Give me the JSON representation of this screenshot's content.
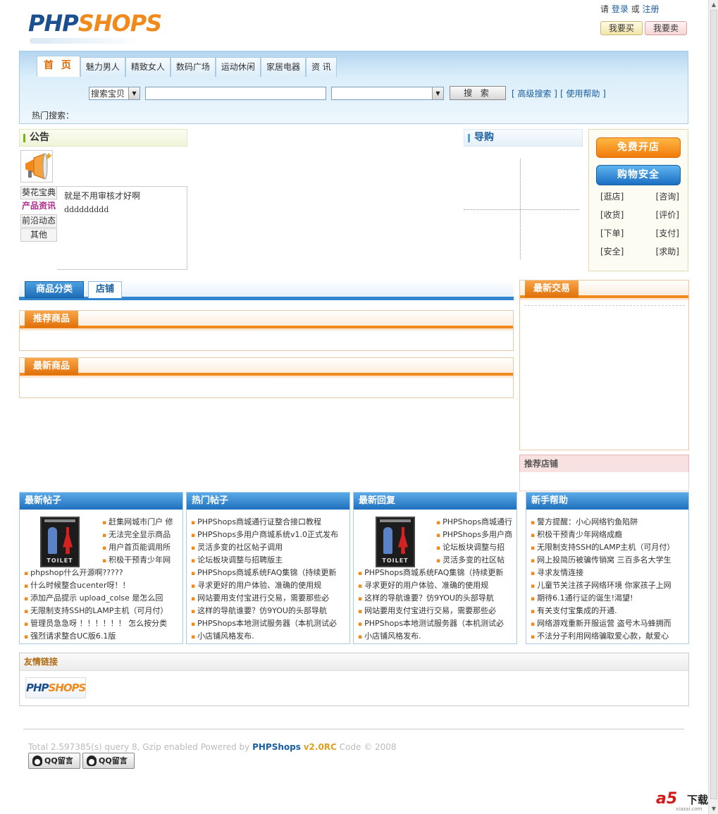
{
  "header": {
    "logo_php": "PHP",
    "logo_shops": "SHOPS",
    "userbar_prefix": "请",
    "login": "登录",
    "or": "或",
    "register": "注册",
    "buy_btn": "我要买",
    "sell_btn": "我要卖"
  },
  "nav": {
    "tabs": [
      "首 页",
      "魅力男人",
      "精致女人",
      "数码广场",
      "运动休闲",
      "家居电器",
      "资 讯"
    ],
    "search_type": "搜索宝贝",
    "search_value": "",
    "search_btn": "搜 索",
    "adv_search": "[ 高级搜索 ]",
    "help": "[ 使用帮助 ]",
    "hot_search": "热门搜索："
  },
  "notice": {
    "title": "公告",
    "cats": [
      "葵花宝典",
      "产品资讯",
      "前沿动态",
      "其他"
    ],
    "line1": "就是不用审核才好啊",
    "line2": "ddddddddd"
  },
  "guide": {
    "title": "导购"
  },
  "rightpanel": {
    "open_btn": "免费开店",
    "safe_btn": "购物安全",
    "links": [
      "[逛店]",
      "[咨询]",
      "[收货]",
      "[评价]",
      "[下单]",
      "[支付]",
      "[安全]",
      "[求助]"
    ]
  },
  "sections": {
    "cat_tab": "商品分类",
    "store_tab": "店铺",
    "recommend": "推荐商品",
    "newest": "最新商品",
    "latest_trade": "最新交易",
    "rec_store": "推荐店铺"
  },
  "posts": {
    "latest": {
      "title": "最新帖子",
      "items": [
        "赶集网城市门户 修",
        "无法完全显示商品",
        "用户首页能调用所",
        "积极干预青少年网",
        "phpshop什么开源啊?????",
        "什么时候整合ucenter呀！！",
        "添加产品提示 upload_colse 是怎么回",
        "无限制支持SSH的LAMP主机（可月付）",
        "管理员急急呀 ！！！！！！ 怎么按分类",
        "强烈请求整合UC版6.1版"
      ]
    },
    "hot": {
      "title": "热门帖子",
      "items": [
        "PHPShops商城通行证整合接口教程",
        "PHPShops多用户商城系统v1.0正式发布",
        "灵活多变的社区帖子调用",
        "论坛板块调整与招聘版主",
        "PHPShops商城系统FAQ集锦（持续更新",
        "寻求更好的用户体验、准确的使用规",
        "网站要用支付宝进行交易，需要那些必",
        "这样的导航谁要？仿9YOU的头部导航",
        "PHPShops本地测试服务器（本机测试必",
        "小店铺风格发布."
      ]
    },
    "reply": {
      "title": "最新回复",
      "items": [
        "PHPShops商城通行",
        "PHPShops多用户商",
        "论坛板块调整与招",
        "灵活多变的社区帖",
        "PHPShops商城系统FAQ集锦（持续更新",
        "寻求更好的用户体验、准确的使用规",
        "这样的导航谁要？仿9YOU的头部导航",
        "网站要用支付宝进行交易，需要那些必",
        "PHPShops本地测试服务器（本机测试必",
        "小店铺风格发布."
      ]
    },
    "help": {
      "title": "新手帮助",
      "items": [
        "警方提醒：小心网络钓鱼陷阱",
        "积极干预青少年网络成瘾",
        "无限制支持SSH的LAMP主机（可月付）",
        "网上投简历被骗传销窝 三百多名大学生",
        "寻求友情连接",
        "儿童节关注孩子网络环境 你家孩子上网",
        "期待6.1通行证的诞生!渴望!",
        "有关支付宝集成的开通.",
        "网络游戏重新开服运营 盗号木马蜂拥而",
        "不法分子利用网络骗取爱心款，献爱心"
      ]
    },
    "toilet_label": "TOILET"
  },
  "friend": {
    "title": "友情链接",
    "logo_php": "PHP",
    "logo_shops": "SHOPS"
  },
  "footer": {
    "stats": "Total 2.597385(s) query 8, Gzip enabled Powered by ",
    "brand": "PHPShops",
    "version": "v2.0RC",
    "code": " Code © 2008",
    "qq1": "QQ留言",
    "qq2": "QQ留言"
  },
  "watermark": {
    "mark": "a5",
    "zh": "下载",
    "url": "xiazai.com"
  }
}
